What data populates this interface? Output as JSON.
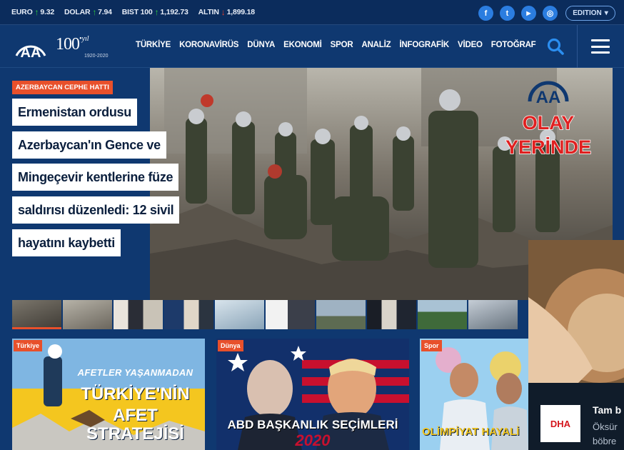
{
  "ticker": [
    {
      "name": "EURO",
      "dir": "up",
      "value": "9.32"
    },
    {
      "name": "DOLAR",
      "dir": "up",
      "value": "7.94"
    },
    {
      "name": "BIST 100",
      "dir": "up",
      "value": "1,192.73"
    },
    {
      "name": "ALTIN",
      "dir": "down",
      "value": "1,899.18"
    }
  ],
  "social": {
    "facebook": "f",
    "twitter": "t",
    "youtube": "▶",
    "instagram": "◎"
  },
  "edition": {
    "label": "EDITION",
    "caret": "▾"
  },
  "brand": {
    "logo_text": "AA",
    "anniv_number": "100",
    "anniv_word": "•yıl",
    "anniv_years": "1920-2020"
  },
  "menu": [
    "TÜRKİYE",
    "KORONAVİRÜS",
    "DÜNYA",
    "EKONOMİ",
    "SPOR",
    "ANALİZ",
    "İNFOGRAFİK",
    "VİDEO",
    "FOTOĞRAF"
  ],
  "hero": {
    "category": "AZERBAYCAN CEPHE HATTI",
    "lines": [
      "Ermenistan ordusu",
      "Azerbaycan'ın Gence ve",
      "Mingeçevir kentlerine füze",
      "saldırısı düzenledi: 12 sivil",
      "hayatını kaybetti"
    ],
    "badge_line1": "OLAY",
    "badge_line2": "YERİNDE",
    "badge_logo": "AA"
  },
  "cards": [
    {
      "label": "Türkiye",
      "text_top": "AFETLER YAŞANMADAN",
      "text_mid": "TÜRKİYE'NİN",
      "text_bot1": "AFET",
      "text_bot2": "STRATEJİSİ"
    },
    {
      "label": "Dünya",
      "text_main": "ABD BAŞKANLIK SEÇİMLERİ",
      "text_year": "2020"
    },
    {
      "label": "Spor",
      "text_main": "OLİMPİYAT HAYALİ"
    }
  ],
  "ad": {
    "logo": "DHA",
    "title": "Tam b",
    "line1": "Öksür",
    "line2": "böbre"
  },
  "colors": {
    "accent": "#e8502b",
    "nav": "#0f3870",
    "ticker": "#0b2c5c",
    "link_blue": "#2b7de0"
  }
}
